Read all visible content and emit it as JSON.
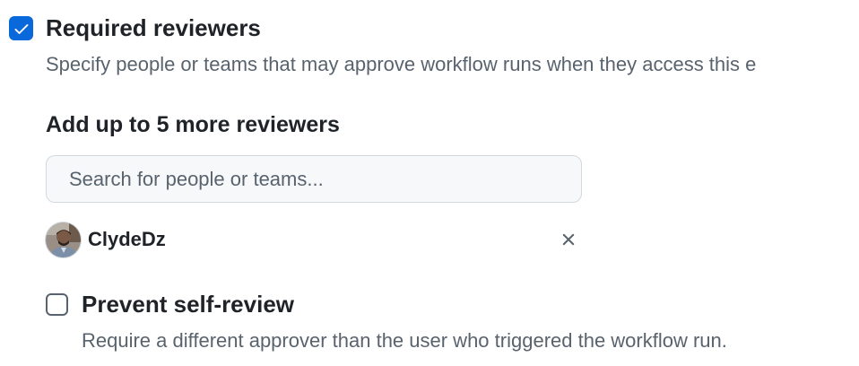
{
  "required_reviewers": {
    "checked": true,
    "title": "Required reviewers",
    "description": "Specify people or teams that may approve workflow runs when they access this e"
  },
  "add_reviewers": {
    "heading": "Add up to 5 more reviewers",
    "search_placeholder": "Search for people or teams..."
  },
  "reviewers": [
    {
      "username": "ClydeDz",
      "avatar_icon": "user-avatar",
      "remove_icon": "x-icon"
    }
  ],
  "prevent_self_review": {
    "checked": false,
    "title": "Prevent self-review",
    "description": "Require a different approver than the user who triggered the workflow run."
  },
  "colors": {
    "accent": "#0969da",
    "text_primary": "#1f2328",
    "text_muted": "#59636e",
    "border": "#d1d9e0",
    "input_bg": "#f6f8fa"
  }
}
